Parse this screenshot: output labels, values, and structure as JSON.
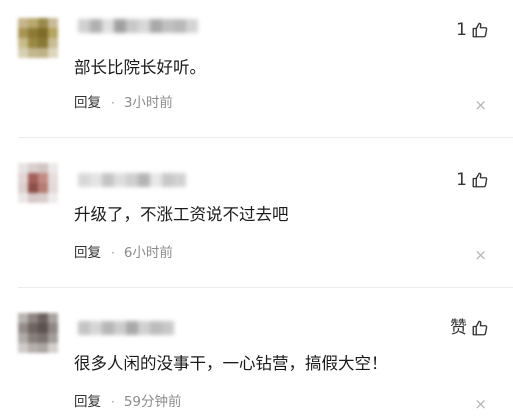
{
  "comments": [
    {
      "text": "部长比院长好听。",
      "reply_label": "回复",
      "separator": "·",
      "time": "3小时前",
      "likes": "1",
      "close_label": "×",
      "like_icon": "thumbs-up-icon",
      "avatar_colors": [
        "#c5b58c",
        "#b8a96f",
        "#9a8a4a",
        "#c7bb98",
        "#a89556",
        "#8c7a35",
        "#7d6b2a",
        "#b6a460",
        "#c8bb8c",
        "#9a8843",
        "#8a7837",
        "#c9bd95",
        "#d8d0b4",
        "#c3b78e",
        "#bfb286",
        "#dcd5bd"
      ],
      "username_colors": [
        "#d0d0d0",
        "#b0b0b0",
        "#e0e0e0",
        "#a0a0a0",
        "#c8c8c8",
        "#d8d8d8",
        "#a8a8a8",
        "#c0c0c0",
        "#b8b8b8",
        "#d4d4d4"
      ]
    },
    {
      "text": "升级了，不涨工资说不过去吧",
      "reply_label": "回复",
      "separator": "·",
      "time": "6小时前",
      "likes": "1",
      "close_label": "×",
      "like_icon": "thumbs-up-icon",
      "avatar_colors": [
        "#e7e3e3",
        "#d9cfcf",
        "#d3c5c3",
        "#ece8e8",
        "#e2d6d4",
        "#a2605a",
        "#c28b82",
        "#e5dcdb",
        "#dcd0cf",
        "#8c4f49",
        "#b57d74",
        "#e2dad9",
        "#ece7e7",
        "#d6c8c6",
        "#d9cdcc",
        "#efebeb"
      ],
      "username_colors": [
        "#d8d8d8",
        "#e4e4e4",
        "#c4c4c4",
        "#dedede",
        "#cfcfcf",
        "#b4b4b4",
        "#e8e8e8",
        "#c8c8c8",
        "#d2d2d2"
      ]
    },
    {
      "text": "很多人闲的没事干，一心钻营，搞假大空！",
      "reply_label": "回复",
      "separator": "·",
      "time": "59分钟前",
      "likes": "赞",
      "close_label": "×",
      "like_icon": "thumbs-up-icon",
      "avatar_colors": [
        "#b9b4b1",
        "#8d8582",
        "#6b625f",
        "#aaa3a0",
        "#958c89",
        "#6e6561",
        "#5c5350",
        "#8f8784",
        "#b1aba8",
        "#877f7b",
        "#7b726e",
        "#a39d9a",
        "#cfcbc9",
        "#b5afac",
        "#aca6a3",
        "#d4d0ce"
      ],
      "username_colors": [
        "#c4c4c4",
        "#d6d6d6",
        "#b6b6b6",
        "#cdcdcd",
        "#a8a8a8",
        "#d0d0d0",
        "#bcbcbc",
        "#c8c8c8"
      ]
    }
  ]
}
